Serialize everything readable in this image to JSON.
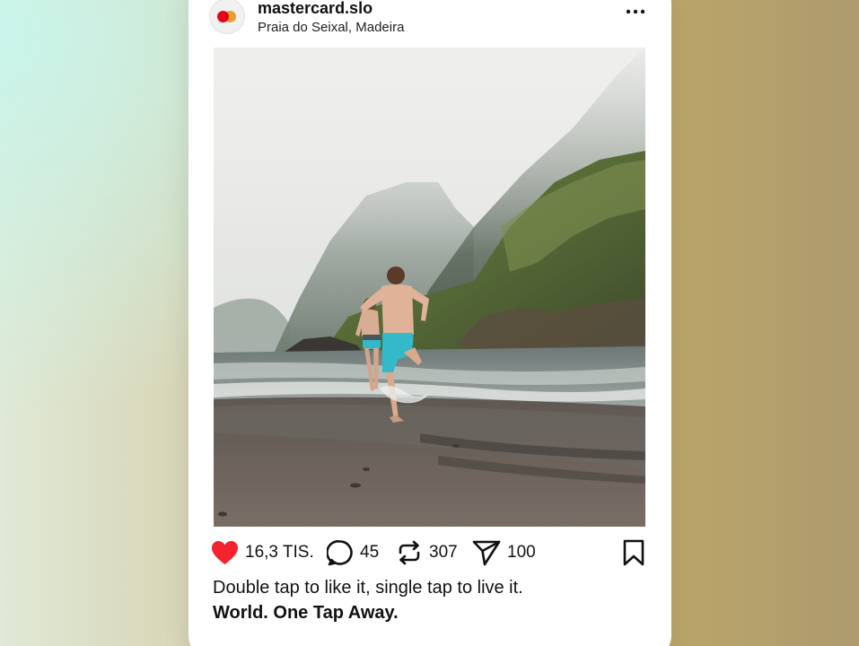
{
  "post": {
    "username": "mastercard.slo",
    "location": "Praia do Seixal, Madeira",
    "likes": "16,3 TIS.",
    "comments": "45",
    "reposts": "307",
    "shares": "100",
    "caption": "Double tap to like it, single tap to live it.",
    "tagline": "World. One Tap Away."
  },
  "colors": {
    "like": "#f4242f",
    "brand_red": "#eb001b",
    "brand_orange": "#f79e1b",
    "swim_shorts": "#35b8c9"
  },
  "icons": {
    "more": "more-horizontal-icon",
    "like": "heart-icon",
    "comment": "comment-icon",
    "repost": "repost-icon",
    "share": "send-icon",
    "save": "bookmark-icon"
  }
}
